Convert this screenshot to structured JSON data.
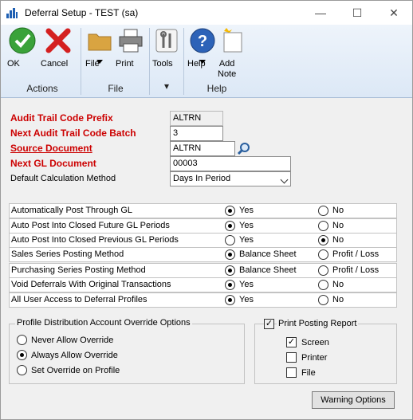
{
  "window": {
    "title": "Deferral Setup  -  TEST (sa)"
  },
  "ribbon": {
    "ok": "OK",
    "cancel": "Cancel",
    "file": "File",
    "print": "Print",
    "tools": "Tools",
    "help": "Help",
    "add_note": "Add\nNote",
    "groups": {
      "actions": "Actions",
      "file": "File",
      "help": "Help"
    }
  },
  "form": {
    "audit_prefix_label": "Audit Trail Code Prefix",
    "audit_prefix_value": "ALTRN",
    "next_batch_label": "Next Audit Trail Code Batch",
    "next_batch_value": "3",
    "source_doc_label": "Source Document",
    "source_doc_value": "ALTRN",
    "next_gl_label": "Next GL Document",
    "next_gl_value": "00003",
    "calc_method_label": "Default Calculation Method",
    "calc_method_value": "Days In Period"
  },
  "options": [
    {
      "label": "Automatically Post Through GL",
      "a": "Yes",
      "b": "No",
      "sel": "a"
    },
    {
      "label": "Auto Post Into Closed Future GL Periods",
      "a": "Yes",
      "b": "No",
      "sel": "a"
    },
    {
      "label": "Auto Post Into Closed Previous GL Periods",
      "a": "Yes",
      "b": "No",
      "sel": "b"
    },
    {
      "label": "Sales Series Posting Method",
      "a": "Balance Sheet",
      "b": "Profit / Loss",
      "sel": "a"
    },
    {
      "label": "Purchasing Series Posting Method",
      "a": "Balance Sheet",
      "b": "Profit / Loss",
      "sel": "a"
    },
    {
      "label": "Void Deferrals With Original Transactions",
      "a": "Yes",
      "b": "No",
      "sel": "a"
    },
    {
      "label": "All User Access to Deferral Profiles",
      "a": "Yes",
      "b": "No",
      "sel": "a"
    }
  ],
  "profile_override": {
    "title": "Profile Distribution Account Override Options",
    "never": "Never Allow Override",
    "always": "Always Allow Override",
    "set": "Set Override on Profile"
  },
  "print_posting": {
    "title": "Print Posting Report",
    "screen": "Screen",
    "printer": "Printer",
    "file": "File"
  },
  "warning_button": "Warning Options"
}
